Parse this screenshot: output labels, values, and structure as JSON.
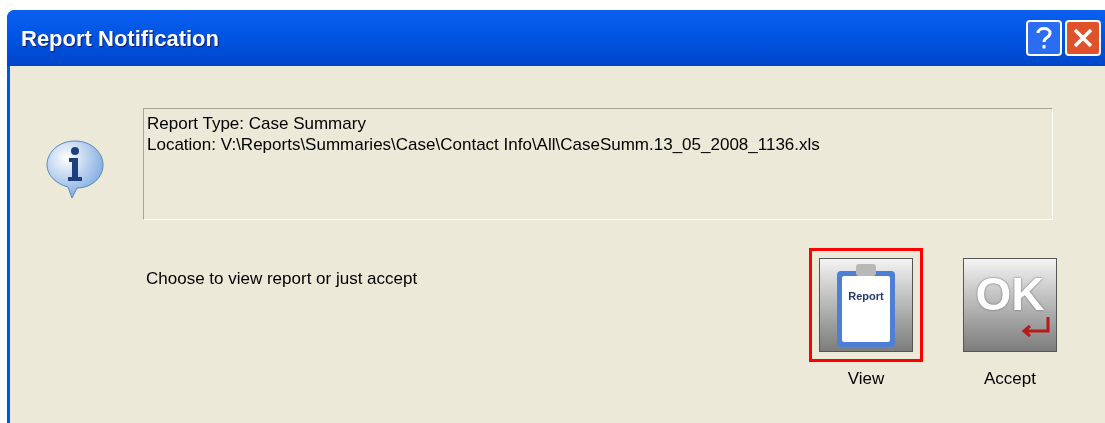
{
  "window": {
    "title": "Report Notification"
  },
  "message": {
    "lines": [
      "Report Type: Case Summary",
      "Location: V:\\Reports\\Summaries\\Case\\Contact Info\\All\\CaseSumm.13_05_2008_1136.xls"
    ]
  },
  "prompt": "Choose to view report or just accept",
  "buttons": [
    {
      "kind": "report",
      "icon_text": "Report",
      "label": "View",
      "focused": true
    },
    {
      "kind": "ok",
      "icon_text": "OK",
      "label": "Accept",
      "focused": false
    }
  ]
}
